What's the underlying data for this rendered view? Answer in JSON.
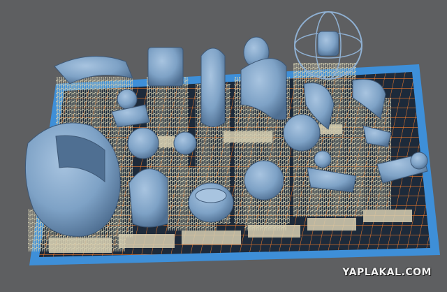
{
  "app": {
    "view": "3d-print-build-plate-preview"
  },
  "colors": {
    "background": "#5e5f61",
    "build_plate": "#3e8fd8",
    "plate_grid": "#f07a2a",
    "raft": "#d8cfb2",
    "supports": "#cbc6a8",
    "model": "#7ea2c6",
    "model_shadow": "#4f6f92"
  },
  "watermark": {
    "text": "YAPLAKAL.COM"
  }
}
